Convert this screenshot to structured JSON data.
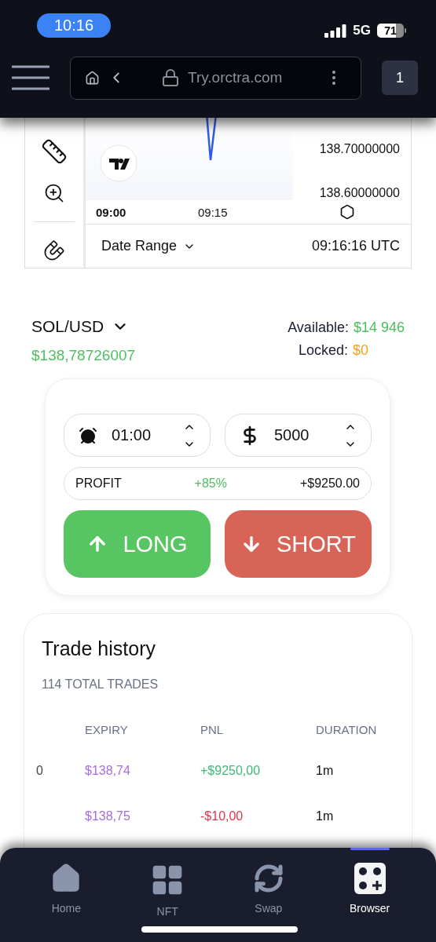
{
  "status_bar": {
    "time": "10:16",
    "network": "5G",
    "battery": "71"
  },
  "browser": {
    "url": "Try.orctra.com",
    "tab_count": "1"
  },
  "chart": {
    "y_labels": [
      "138.70000000",
      "138.60000000"
    ],
    "x_labels": [
      {
        "label": "09:00",
        "bold": true
      },
      {
        "label": "09:15",
        "bold": false
      }
    ],
    "date_range": "Date Range",
    "clock": "09:16:16 UTC"
  },
  "market": {
    "pair": "SOL/USD",
    "price": "$138,78726007",
    "available_label": "Available:",
    "available": "$14 946",
    "locked_label": "Locked:",
    "locked": "$0"
  },
  "order": {
    "duration": "01:00",
    "amount": "5000",
    "profit_label": "PROFIT",
    "profit_percent": "+85%",
    "profit_amount": "+$9250.00",
    "buttons": [
      {
        "kind": "long",
        "label": "LONG"
      },
      {
        "kind": "short",
        "label": "SHORT"
      }
    ]
  },
  "trade_history": {
    "title": "Trade history",
    "total": "114 TOTAL TRADES",
    "columns": [
      "EXPIRY",
      "PNL",
      "DURATION"
    ],
    "rows": [
      {
        "column_1": "0",
        "expiry": "$138,74",
        "pnl": "+$9250,00",
        "color": "#3cb878",
        "duration": "1m"
      },
      {
        "expiry": "$138,75",
        "pnl": "-$10,00",
        "color": "#e0344f",
        "duration": "1m"
      }
    ]
  },
  "bottom_nav": [
    {
      "label": "Home",
      "selected": false
    },
    {
      "label": "NFT",
      "selected": false
    },
    {
      "label": "Swap",
      "selected": false
    },
    {
      "label": "Browser",
      "selected": true
    }
  ]
}
